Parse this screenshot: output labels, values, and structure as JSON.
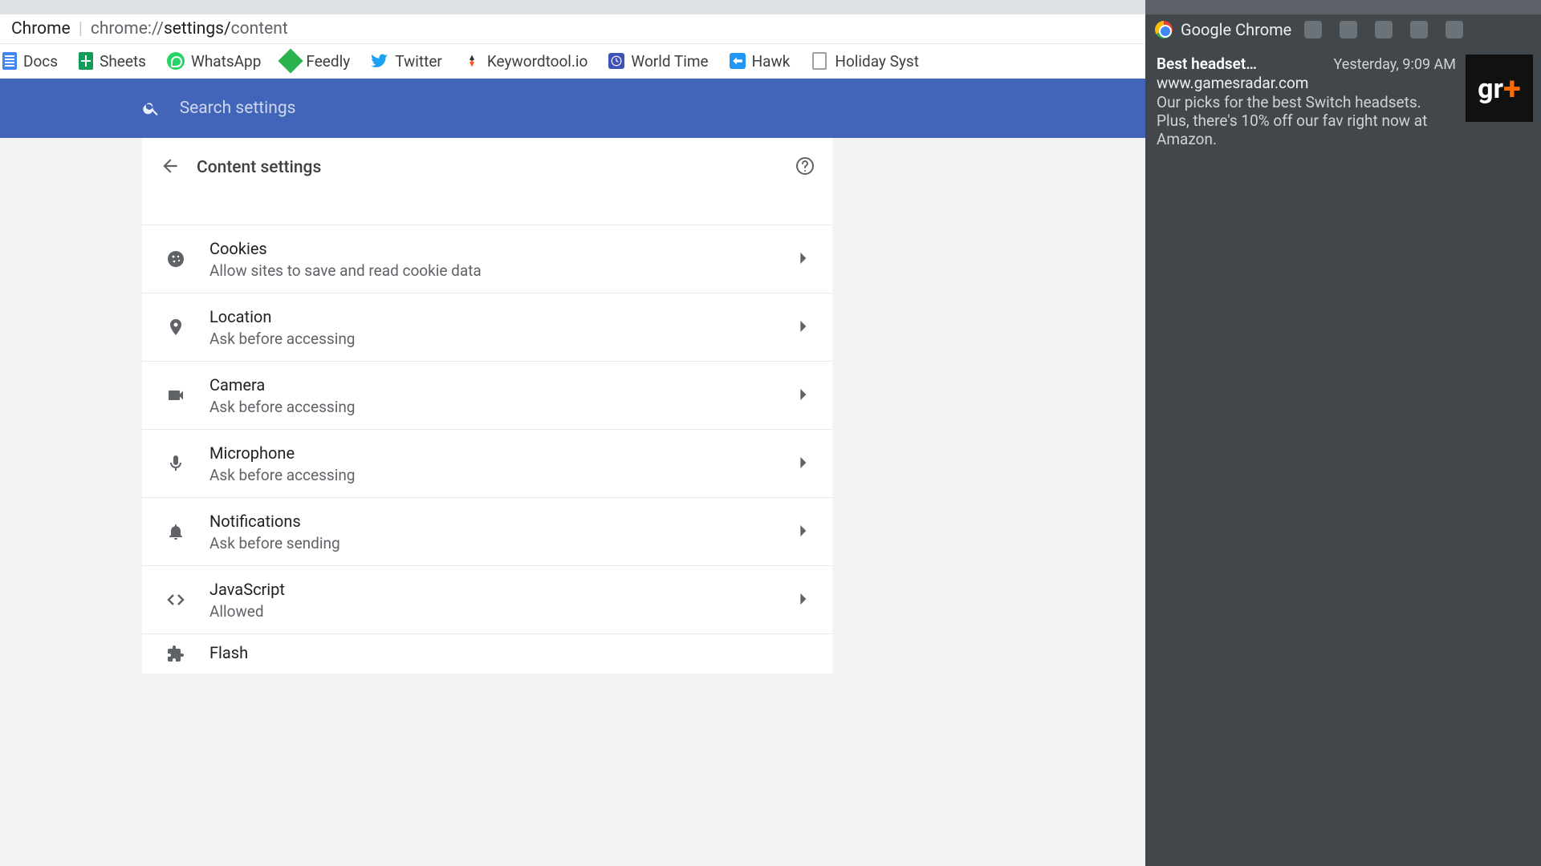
{
  "address_bar": {
    "app_name": "Chrome",
    "url_prefix": "chrome://",
    "url_path": "settings/",
    "url_page": "content"
  },
  "bookmarks": [
    {
      "label": "Docs",
      "icon": "docs-icon"
    },
    {
      "label": "Sheets",
      "icon": "sheets-icon"
    },
    {
      "label": "WhatsApp",
      "icon": "whatsapp-icon"
    },
    {
      "label": "Feedly",
      "icon": "feedly-icon"
    },
    {
      "label": "Twitter",
      "icon": "twitter-icon"
    },
    {
      "label": "Keywordtool.io",
      "icon": "keywordtool-icon"
    },
    {
      "label": "World Time",
      "icon": "worldtime-icon"
    },
    {
      "label": "Hawk",
      "icon": "hawk-icon"
    },
    {
      "label": "Holiday Syst",
      "icon": "document-icon"
    }
  ],
  "search": {
    "placeholder": "Search settings"
  },
  "panel": {
    "title": "Content settings",
    "items": [
      {
        "icon": "cookie-icon",
        "title": "Cookies",
        "sub": "Allow sites to save and read cookie data"
      },
      {
        "icon": "location-icon",
        "title": "Location",
        "sub": "Ask before accessing"
      },
      {
        "icon": "camera-icon",
        "title": "Camera",
        "sub": "Ask before accessing"
      },
      {
        "icon": "microphone-icon",
        "title": "Microphone",
        "sub": "Ask before accessing"
      },
      {
        "icon": "bell-icon",
        "title": "Notifications",
        "sub": "Ask before sending"
      },
      {
        "icon": "code-icon",
        "title": "JavaScript",
        "sub": "Allowed"
      },
      {
        "icon": "puzzle-icon",
        "title": "Flash",
        "sub": ""
      }
    ]
  },
  "notification_center": {
    "header": "Google Chrome",
    "card": {
      "title": "Best headset…",
      "time": "Yesterday, 9:09 AM",
      "site": "www.gamesradar.com",
      "desc": "Our picks for the best Switch headsets. Plus, there's 10% off our fav right now at Amazon.",
      "thumb_logo_left": "gr",
      "thumb_logo_right": "+"
    }
  },
  "colors": {
    "accent": "#4265b9"
  }
}
